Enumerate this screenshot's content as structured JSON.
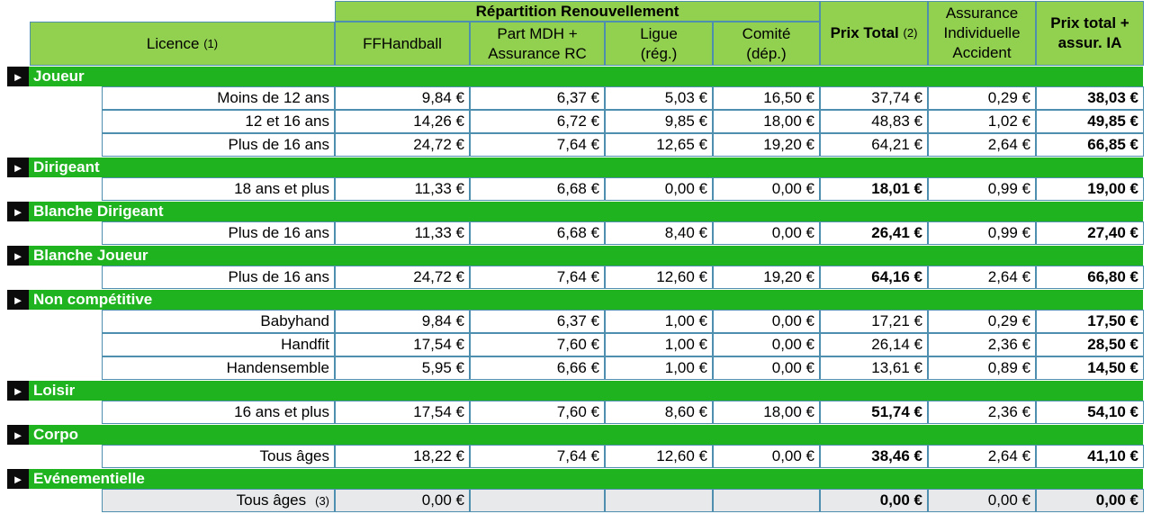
{
  "header": {
    "group": "Répartition Renouvellement",
    "licence": "Licence",
    "licence_note": "(1)",
    "ffhandball": "FFHandball",
    "part_mdh": "Part MDH + Assurance RC",
    "ligue": "Ligue (rég.)",
    "comite": "Comité (dép.)",
    "prix_total": "Prix Total",
    "prix_total_note": "(2)",
    "assurance": "Assurance Individuelle Accident",
    "prix_total_ia": "Prix total + assur. IA"
  },
  "marker": "►",
  "sections": [
    {
      "name": "Joueur",
      "rows": [
        {
          "label": "Moins de 12 ans",
          "values": [
            "9,84 €",
            "6,37 €",
            "5,03 €",
            "16,50 €",
            "37,74 €",
            "0,29 €",
            "38,03 €"
          ]
        },
        {
          "label": "12 et 16 ans",
          "values": [
            "14,26 €",
            "6,72 €",
            "9,85 €",
            "18,00 €",
            "48,83 €",
            "1,02 €",
            "49,85 €"
          ]
        },
        {
          "label": "Plus de 16 ans",
          "values": [
            "24,72 €",
            "7,64 €",
            "12,65 €",
            "19,20 €",
            "64,21 €",
            "2,64 €",
            "66,85 €"
          ]
        }
      ]
    },
    {
      "name": "Dirigeant",
      "rows": [
        {
          "label": "18 ans et plus",
          "values": [
            "11,33 €",
            "6,68 €",
            "0,00 €",
            "0,00 €",
            "18,01 €",
            "0,99 €",
            "19,00 €"
          ]
        }
      ]
    },
    {
      "name": "Blanche Dirigeant",
      "rows": [
        {
          "label": "Plus de 16 ans",
          "values": [
            "11,33 €",
            "6,68 €",
            "8,40 €",
            "0,00 €",
            "26,41 €",
            "0,99 €",
            "27,40 €"
          ]
        }
      ]
    },
    {
      "name": "Blanche Joueur",
      "rows": [
        {
          "label": "Plus de 16 ans",
          "values": [
            "24,72 €",
            "7,64 €",
            "12,60 €",
            "19,20 €",
            "64,16 €",
            "2,64 €",
            "66,80 €"
          ]
        }
      ]
    },
    {
      "name": "Non compétitive",
      "rows": [
        {
          "label": "Babyhand",
          "values": [
            "9,84 €",
            "6,37 €",
            "1,00 €",
            "0,00 €",
            "17,21 €",
            "0,29 €",
            "17,50 €"
          ]
        },
        {
          "label": "Handfit",
          "values": [
            "17,54 €",
            "7,60 €",
            "1,00 €",
            "0,00 €",
            "26,14 €",
            "2,36 €",
            "28,50 €"
          ]
        },
        {
          "label": "Handensemble",
          "values": [
            "5,95 €",
            "6,66 €",
            "1,00 €",
            "0,00 €",
            "13,61 €",
            "0,89 €",
            "14,50 €"
          ]
        }
      ]
    },
    {
      "name": "Loisir",
      "rows": [
        {
          "label": "16 ans et plus",
          "values": [
            "17,54 €",
            "7,60 €",
            "8,60 €",
            "18,00 €",
            "51,74 €",
            "2,36 €",
            "54,10 €"
          ]
        }
      ]
    },
    {
      "name": "Corpo",
      "rows": [
        {
          "label": "Tous âges",
          "values": [
            "18,22 €",
            "7,64 €",
            "12,60 €",
            "0,00 €",
            "38,46 €",
            "2,64 €",
            "41,10 €"
          ]
        }
      ]
    },
    {
      "name": "Evénementielle",
      "rows": [
        {
          "label": "Tous âges",
          "note": "(3)",
          "values": [
            "0,00 €",
            "",
            "",
            "",
            "0,00 €",
            "0,00 €",
            "0,00 €"
          ]
        }
      ]
    }
  ],
  "colors": {
    "header_green": "#92d050",
    "section_green": "#1fb41f",
    "border_blue": "#4e8fb0",
    "marker_bg": "#0b0b0b",
    "gray_row": "#e7e9ea"
  }
}
